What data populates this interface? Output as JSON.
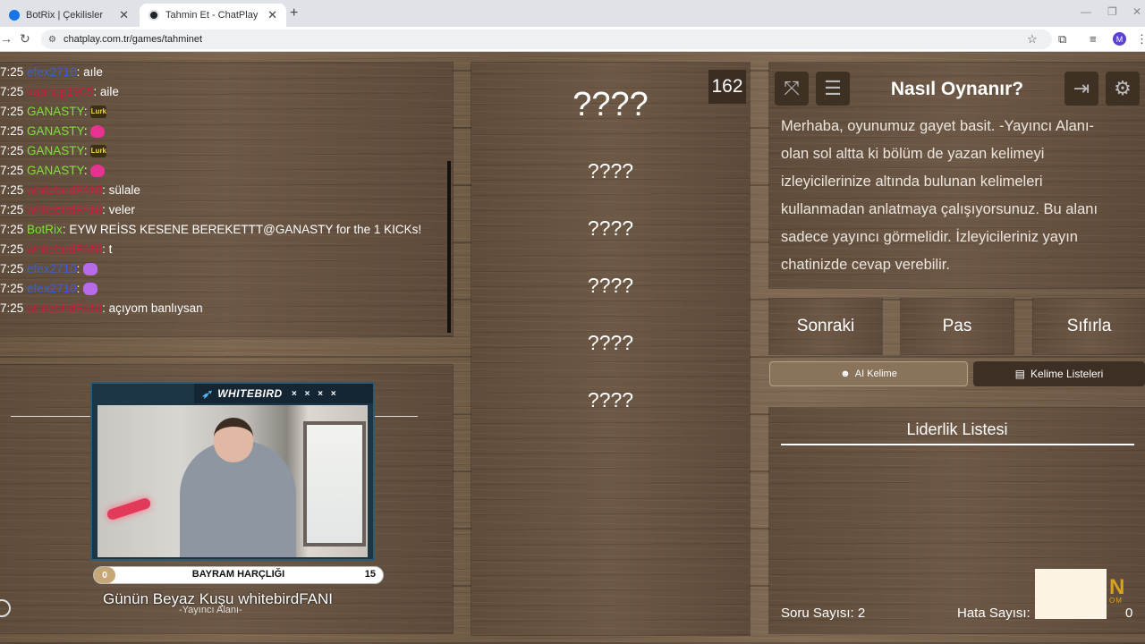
{
  "browser": {
    "tabs": [
      {
        "title": "BotRix | Çekilisler",
        "favicon_color": "#1a73e8"
      },
      {
        "title": "Tahmin Et - ChatPlay",
        "favicon_color": "#20232a"
      }
    ],
    "new_tab": "+",
    "url": "chatplay.com.tr/games/tahminet",
    "profile_initial": "M"
  },
  "chat": {
    "messages": [
      {
        "time": "7:25",
        "user": "efex2710",
        "color": "#3a5fd0",
        "text": "aıle"
      },
      {
        "time": "7:25",
        "user": "kaanpp1905",
        "color": "#c81e3c",
        "text": "aile"
      },
      {
        "time": "7:25",
        "user": "GANASTY",
        "color": "#7fe03a",
        "text": "",
        "emote": "lurk"
      },
      {
        "time": "7:25",
        "user": "GANASTY",
        "color": "#7fe03a",
        "text": "",
        "emote": "pink"
      },
      {
        "time": "7:25",
        "user": "GANASTY",
        "color": "#7fe03a",
        "text": "",
        "emote": "lurk"
      },
      {
        "time": "7:25",
        "user": "GANASTY",
        "color": "#7fe03a",
        "text": "",
        "emote": "pink"
      },
      {
        "time": "7:25",
        "user": "whitebirdFANI",
        "color": "#c81e3c",
        "text": "sülale"
      },
      {
        "time": "7:25",
        "user": "whitebirdFANI",
        "color": "#c81e3c",
        "text": "veler"
      },
      {
        "time": "7:25",
        "user": "BotRix",
        "color": "#7fe03a",
        "text": "EYW REİSS KESENE BEREKETTT@GANASTY for the 1 KICKs!"
      },
      {
        "time": "7:25",
        "user": "whitebirdFANI",
        "color": "#c81e3c",
        "text": "t"
      },
      {
        "time": "7:25",
        "user": "efex2710",
        "color": "#3a5fd0",
        "text": "",
        "emote": "purple"
      },
      {
        "time": "7:25",
        "user": "efex2710",
        "color": "#3a5fd0",
        "text": "",
        "emote": "purple"
      },
      {
        "time": "7:25",
        "user": "whitebirdFANI",
        "color": "#c81e3c",
        "text": "açıyom banlıysan"
      }
    ]
  },
  "stream": {
    "channel_name": "WHITEBIRD",
    "header_marks": "× × × ×",
    "goal_label": "BAYRAM HARÇLIĞI",
    "goal_current": "0",
    "goal_max": "15",
    "goal_fraction": 0,
    "caption": "Günün Beyaz Kuşu whitebirdFANI",
    "subcaption": "-Yayıncı Alanı-"
  },
  "game": {
    "timer": "162",
    "words": [
      "????",
      "????",
      "????",
      "????",
      "????",
      "????"
    ]
  },
  "howto": {
    "title": "Nasıl Oynanır?",
    "text": "Merhaba, oyunumuz gayet basit. -Yayıncı Alanı-\nolan sol altta ki bölüm de yazan kelimeyi\nizleyicilerinize altında bulunan kelimeleri\nkullanmadan anlatmaya çalışıyorsunuz. Bu alanı\nsadece yayıncı görmelidir. İzleyicileriniz yayın\nchatinizde cevap verebilir."
  },
  "actions": {
    "next": "Sonraki",
    "pass": "Pas",
    "reset": "Sıfırla"
  },
  "modes": {
    "ai_word": "AI Kelime",
    "word_lists": "Kelime Listeleri"
  },
  "leaderboard": {
    "title": "Liderlik Listesi",
    "question_count_label": "Soru Sayısı:",
    "question_count": "2",
    "error_count_label": "Hata Sayısı:",
    "trailing_value": "0"
  },
  "overlay_logo": {
    "letter": "N",
    "sub": "OM"
  },
  "colors": {
    "accent_gold": "#c7a776",
    "wood": "#6e5945",
    "chat_green": "#7fe03a",
    "chat_red": "#c81e3c",
    "chat_blue": "#3a5fd0"
  }
}
